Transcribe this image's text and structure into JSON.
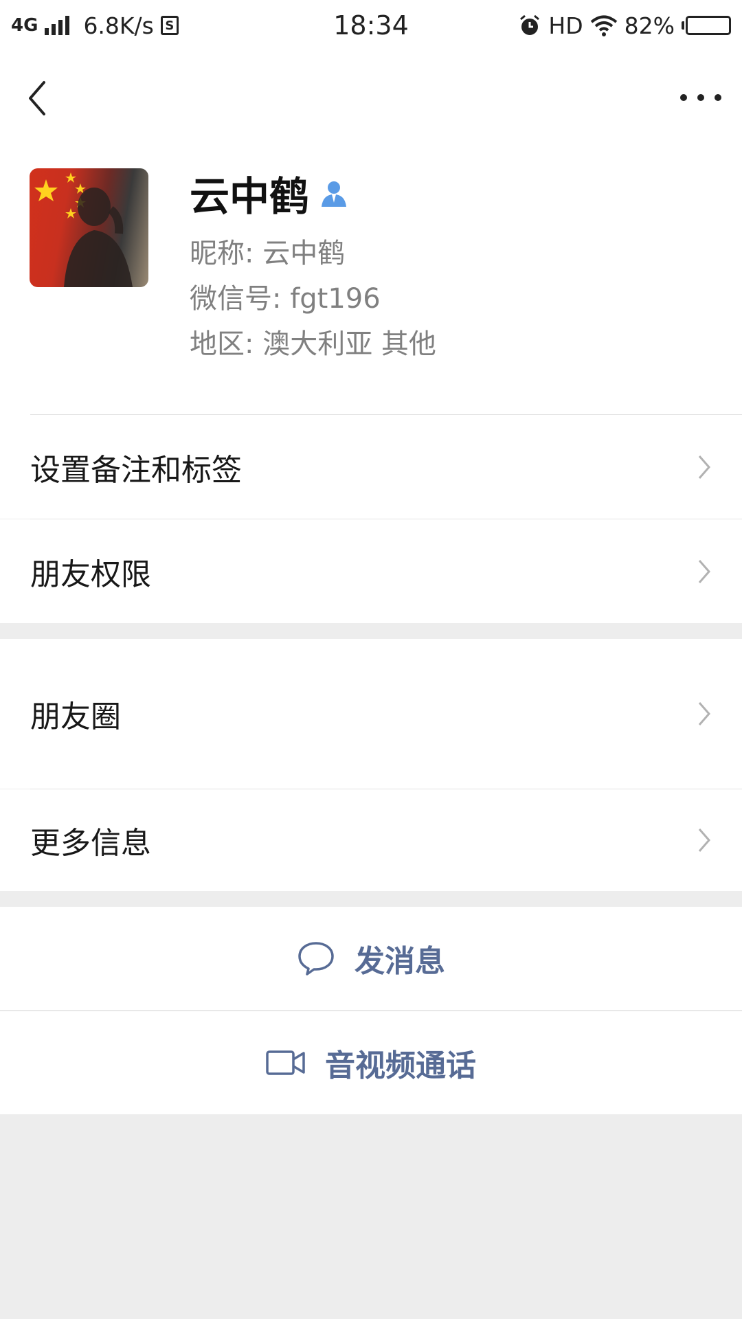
{
  "status_bar": {
    "network": "4G",
    "speed": "6.8K/s",
    "sd_label": "S",
    "time": "18:34",
    "hd": "HD",
    "battery_percent": "82%",
    "battery_level": 0.82
  },
  "profile": {
    "name": "云中鹤",
    "nickname_line": "昵称:  云中鹤",
    "wechat_id_line": "微信号:  fgt196",
    "region_line": "地区:  澳大利亚  其他"
  },
  "menu": {
    "remark_tags": "设置备注和标签",
    "friend_permissions": "朋友权限",
    "moments": "朋友圈",
    "more_info": "更多信息"
  },
  "actions": {
    "send_message": "发消息",
    "video_call": "音视频通话"
  },
  "colors": {
    "link_blue": "#576b95",
    "verify_blue": "#5a9be6",
    "background": "#ededed"
  }
}
